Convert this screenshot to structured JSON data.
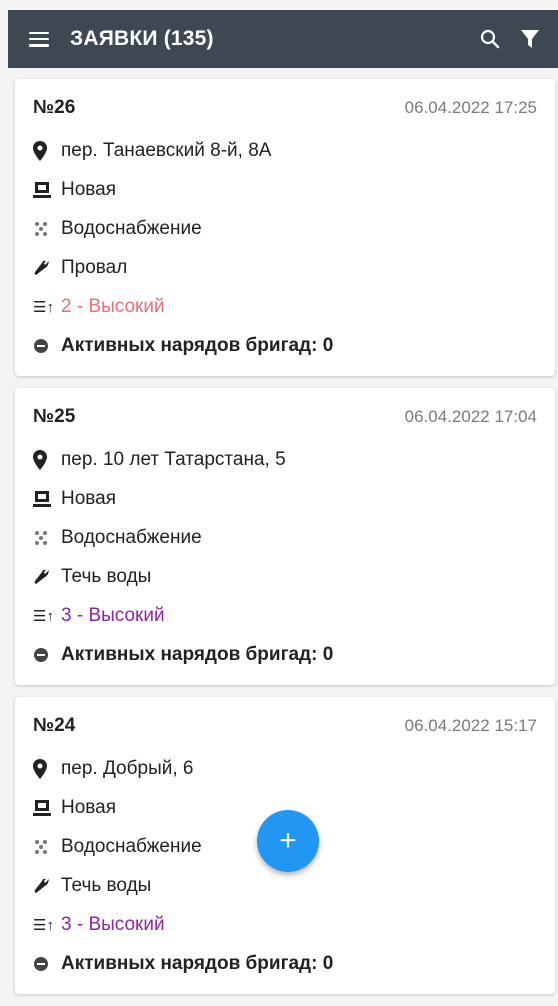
{
  "appbar": {
    "title": "ЗАЯВКИ (135)",
    "menu_icon": "menu-icon",
    "search_icon": "search-icon",
    "filter_icon": "filter-icon"
  },
  "colors": {
    "appbar": "#3d4852",
    "fab": "#2196f3",
    "priority_red": "#ea6f7a",
    "priority_purple": "#8e24aa"
  },
  "requests": [
    {
      "number": "№26",
      "date": "06.04.2022 17:25",
      "address": "пер. Танаевский 8-й, 8А",
      "status": "Новая",
      "service": "Водоснабжение",
      "problem": "Провал",
      "priority": "2 - Высокий",
      "active": "Активных нарядов бригад: 0"
    },
    {
      "number": "№25",
      "date": "06.04.2022 17:04",
      "address": "пер. 10 лет Татарстана, 5",
      "status": "Новая",
      "service": "Водоснабжение",
      "problem": "Течь воды",
      "priority": "3 - Высокий",
      "active": "Активных нарядов бригад: 0"
    },
    {
      "number": "№24",
      "date": "06.04.2022 15:17",
      "address": "пер. Добрый, 6",
      "status": "Новая",
      "service": "Водоснабжение",
      "problem": "Течь воды",
      "priority": "3 - Высокий",
      "active": "Активных нарядов бригад: 0"
    }
  ],
  "fab": {
    "label": "+"
  }
}
